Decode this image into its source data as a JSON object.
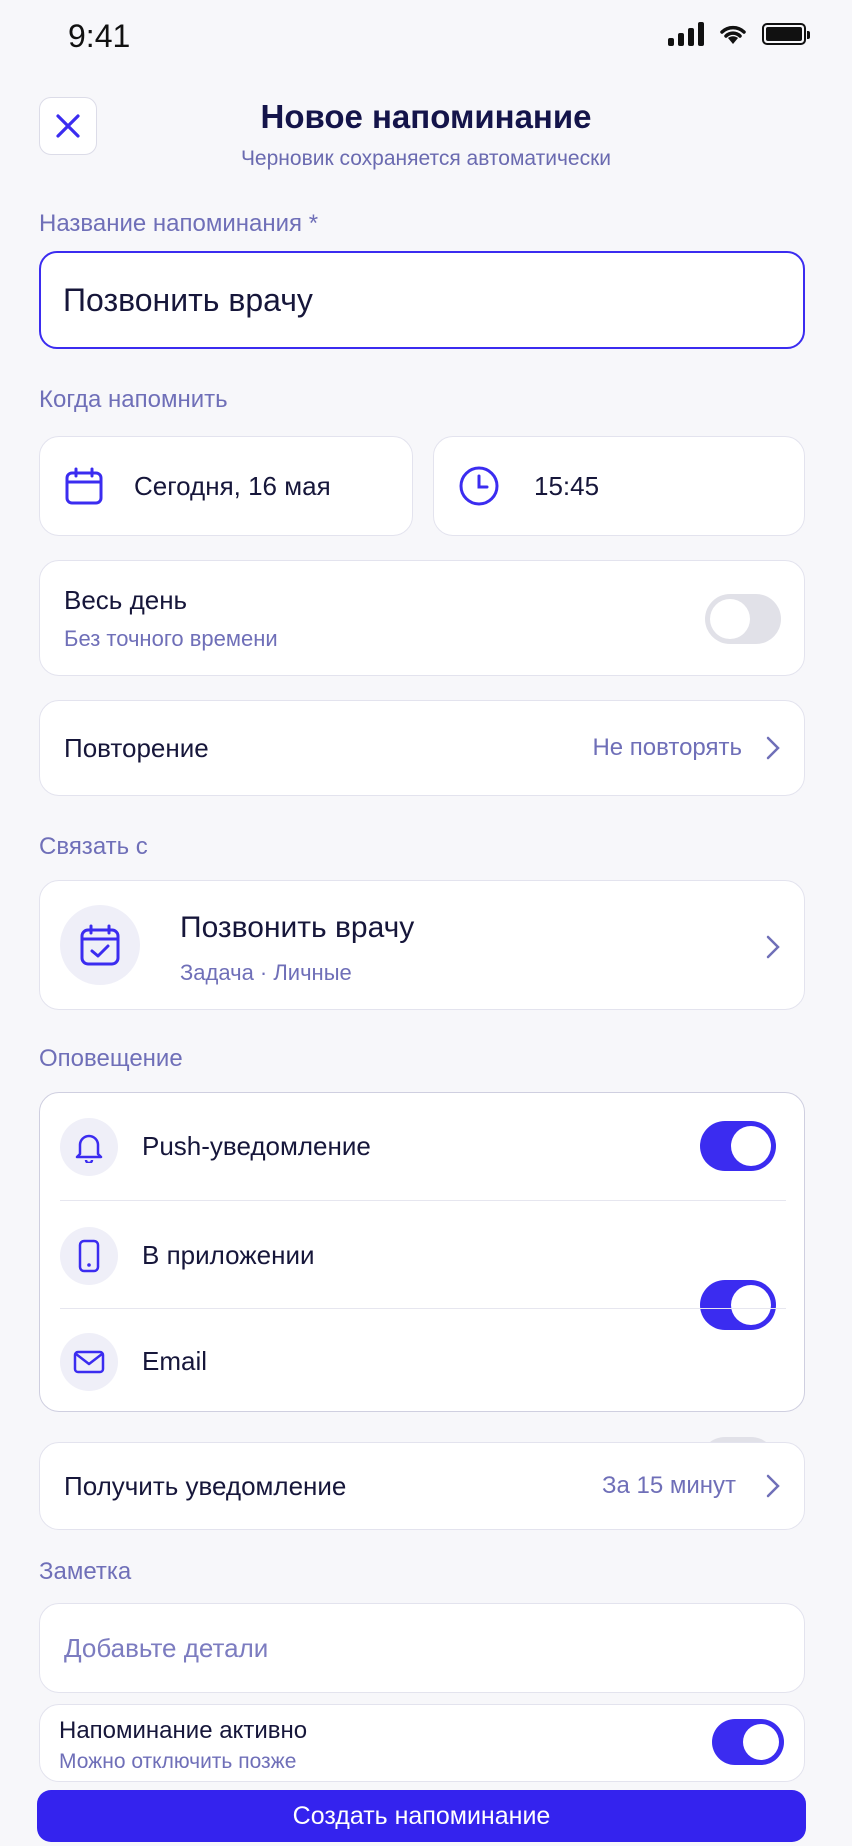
{
  "status_bar": {
    "time": "9:41"
  },
  "header": {
    "title": "Новое напоминание",
    "subtitle": "Черновик сохраняется автоматически"
  },
  "name_field": {
    "label": "Название напоминания *",
    "value": "Позвонить врачу"
  },
  "when": {
    "label": "Когда напомнить",
    "date": "Сегодня, 16 мая",
    "time": "15:45"
  },
  "all_day": {
    "title": "Весь день",
    "subtitle": "Без точного времени",
    "enabled": false
  },
  "repeat": {
    "title": "Повторение",
    "value": "Не повторять"
  },
  "link": {
    "label": "Связать с",
    "title": "Позвонить врачу",
    "meta": "Задача · Личные"
  },
  "notification": {
    "label": "Оповещение",
    "items": [
      {
        "label": "Push-уведомление",
        "icon": "bell-icon",
        "enabled": true
      },
      {
        "label": "В приложении",
        "icon": "phone-icon",
        "enabled": true
      },
      {
        "label": "Email",
        "icon": "mail-icon",
        "enabled": false
      }
    ]
  },
  "receive": {
    "title": "Получить уведомление",
    "value": "За 15 минут"
  },
  "note": {
    "label": "Заметка",
    "placeholder": "Добавьте детали"
  },
  "active": {
    "title": "Напоминание активно",
    "subtitle": "Можно отключить позже",
    "enabled": true
  },
  "submit": {
    "label": "Создать напоминание"
  },
  "colors": {
    "accent": "#3B2CF0",
    "muted": "#6F6FB8",
    "toggle_off": "#E1E1E8"
  }
}
